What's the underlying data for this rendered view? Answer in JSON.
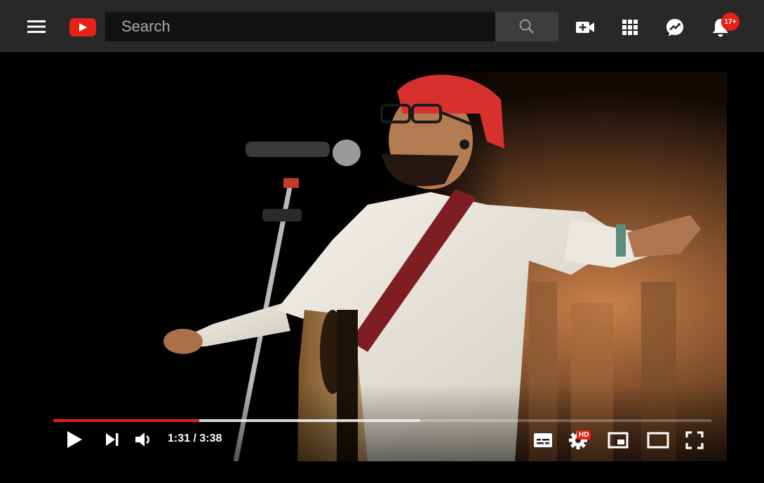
{
  "header": {
    "search": {
      "placeholder": "Search"
    },
    "notification_count": "17+",
    "accent": "#e62117"
  },
  "icons": {
    "menu": "hamburger-menu",
    "logo": "youtube-play-logo",
    "search": "magnifier",
    "upload": "video-camera-plus",
    "apps": "grid-3x3",
    "messages": "chat-bubble-arrow",
    "notifications": "bell"
  },
  "player": {
    "current_time": "1:31",
    "duration": "3:38",
    "time_display": "1:31 / 3:38",
    "progress_fraction": 0.222,
    "buffered_fraction": 0.558,
    "quality_badge": "HD",
    "colors": {
      "played": "#e62117",
      "buffered": "#f0f0f0"
    }
  }
}
